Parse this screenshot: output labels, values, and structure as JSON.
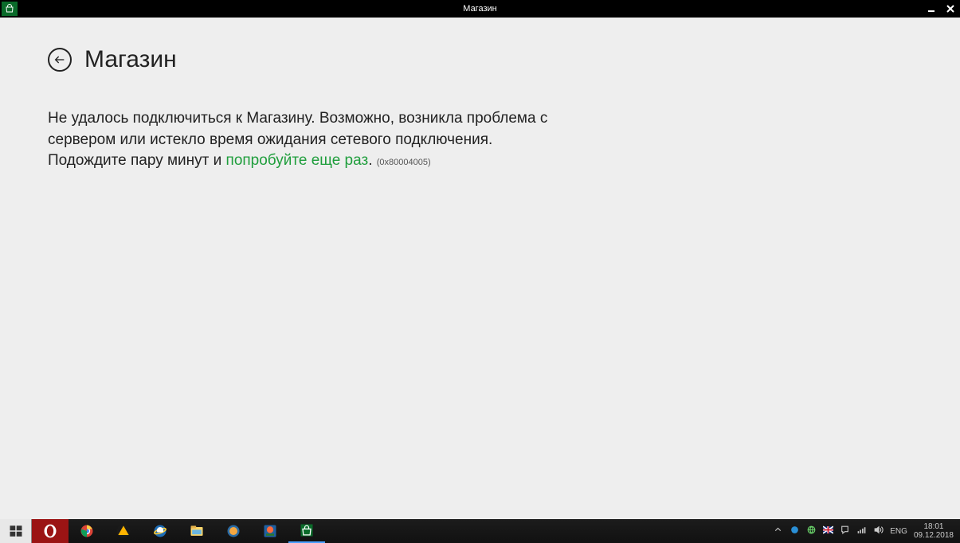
{
  "window": {
    "title": "Магазин"
  },
  "page": {
    "heading": "Магазин",
    "error_text_part1": "Не удалось подключиться к Магазину. Возможно, возникла проблема с сервером или истекло время ожидания сетевого подключения. Подождите пару минут и ",
    "retry_link": "попробуйте еще раз",
    "period": ". ",
    "error_code": "(0x80004005)"
  },
  "taskbar": {
    "language": "ENG",
    "time": "18:01",
    "date": "09.12.2018"
  }
}
